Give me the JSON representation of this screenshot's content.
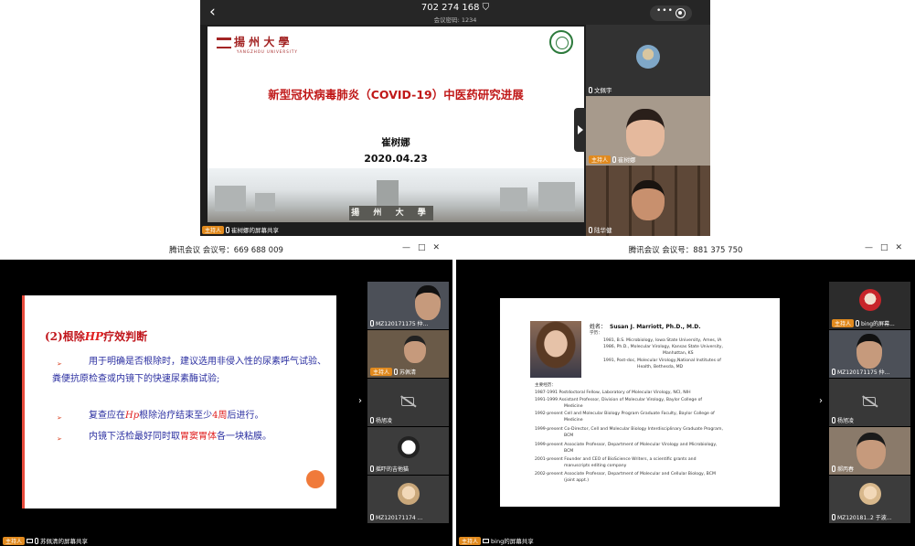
{
  "top_window": {
    "back_icon": "chevron-left-icon",
    "meeting_id": "702 274 168",
    "shield_icon": "shield-icon",
    "passcode": "会议密码: 1234",
    "menu_icon": "more-dots-icon",
    "record_icon": "circle-record-icon",
    "slide": {
      "logo_text": "揚 州 大 學",
      "logo_sub": "YANGZHOU UNIVERSITY",
      "title": "新型冠状病毒肺炎（COVID-19）中医药研究进展",
      "author": "崔树娜",
      "date": "2020.04.23",
      "sign_text": "揚 州 大 學"
    },
    "participants": [
      {
        "name": "文佩宇",
        "host": false
      },
      {
        "name": "崔树娜",
        "host": true
      },
      {
        "name": "陆华健",
        "host": false
      }
    ],
    "host_badge": "主持人",
    "share_label": "崔树娜的屏幕共享"
  },
  "left_window": {
    "title": "腾讯会议 会议号：669 688 009",
    "controls": [
      "—",
      "□",
      "✕"
    ],
    "slide": {
      "heading_prefix": "(2)根除",
      "heading_hp": "HP",
      "heading_suffix": "疗效判断",
      "item1": "用于明确是否根除时，建议选用非侵入性的尿素呼气试验、粪便抗原检查或内镜下的快速尿素酶试验;",
      "item2_a": "复查应在",
      "item2_hp": "Hp",
      "item2_b": "根除治疗结束至少",
      "item2_c": "4周",
      "item2_d": "后进行。",
      "item3_a": "内镜下活检最好同时取",
      "item3_b": "胃窦胃体",
      "item3_c": "各一块粘膜。",
      "bullet": "➢"
    },
    "participants": [
      {
        "name": "MZ120171175 仲..."
      },
      {
        "name": "苏佩清",
        "host": true
      },
      {
        "name": "杨旭凌"
      },
      {
        "name": "摇吓的吉他猫"
      },
      {
        "name": "MZ120171174 ..."
      }
    ],
    "share_label": "苏佩清的屏幕共享"
  },
  "right_window": {
    "title": "腾讯会议 会议号：881 375 750",
    "controls": [
      "—",
      "□",
      "✕"
    ],
    "slide": {
      "name_label": "姓名：",
      "name": "Susan J. Marriott, Ph.D., M.D.",
      "edu_label": "学历：",
      "edu": [
        "1981, B.S. Microbiology, Iowa State University, Ames, IA",
        "1986, Ph.D., Molecular Virology, Kansas State University,",
        "Manhattan, KS",
        "1991, Post-doc, Molecular Virology,National Institutes of",
        "Health, Bethesda, MD"
      ],
      "exp_label": "主要经历：",
      "exp": [
        "1987-1991    Postdoctoral Fellow, Laboratory of Molecular Virology, NCI, NIH",
        "1991-1999    Assistant Professor, Division of Molecular Virology, Baylor College of",
        "Medicine",
        "1992-present  Cell and Molecular Biology Program Graduate Faculty, Baylor College of",
        "Medicine",
        "1999-present  Co-Director, Cell and Molecular Biology Interdisciplinary Graduate Program,",
        "BCM",
        "1999-present  Associate Professor, Department of Molecular Virology and Microbiology,",
        "BCM",
        "2001-present  Founder and CEO of BioScience Writers, a scientific grants and",
        "manuscripts editing company",
        "2002-present  Associate Professor, Department of Molecular and Cellular Biology, BCM",
        "(joint appt.)"
      ]
    },
    "participants": [
      {
        "name": "bing的屏幕...",
        "host": true
      },
      {
        "name": "MZ120171175 仲..."
      },
      {
        "name": "杨旭凌"
      },
      {
        "name": "郝丙春"
      },
      {
        "name": "MZ120181..2 于波..."
      }
    ],
    "share_label": "bing的屏幕共享"
  }
}
